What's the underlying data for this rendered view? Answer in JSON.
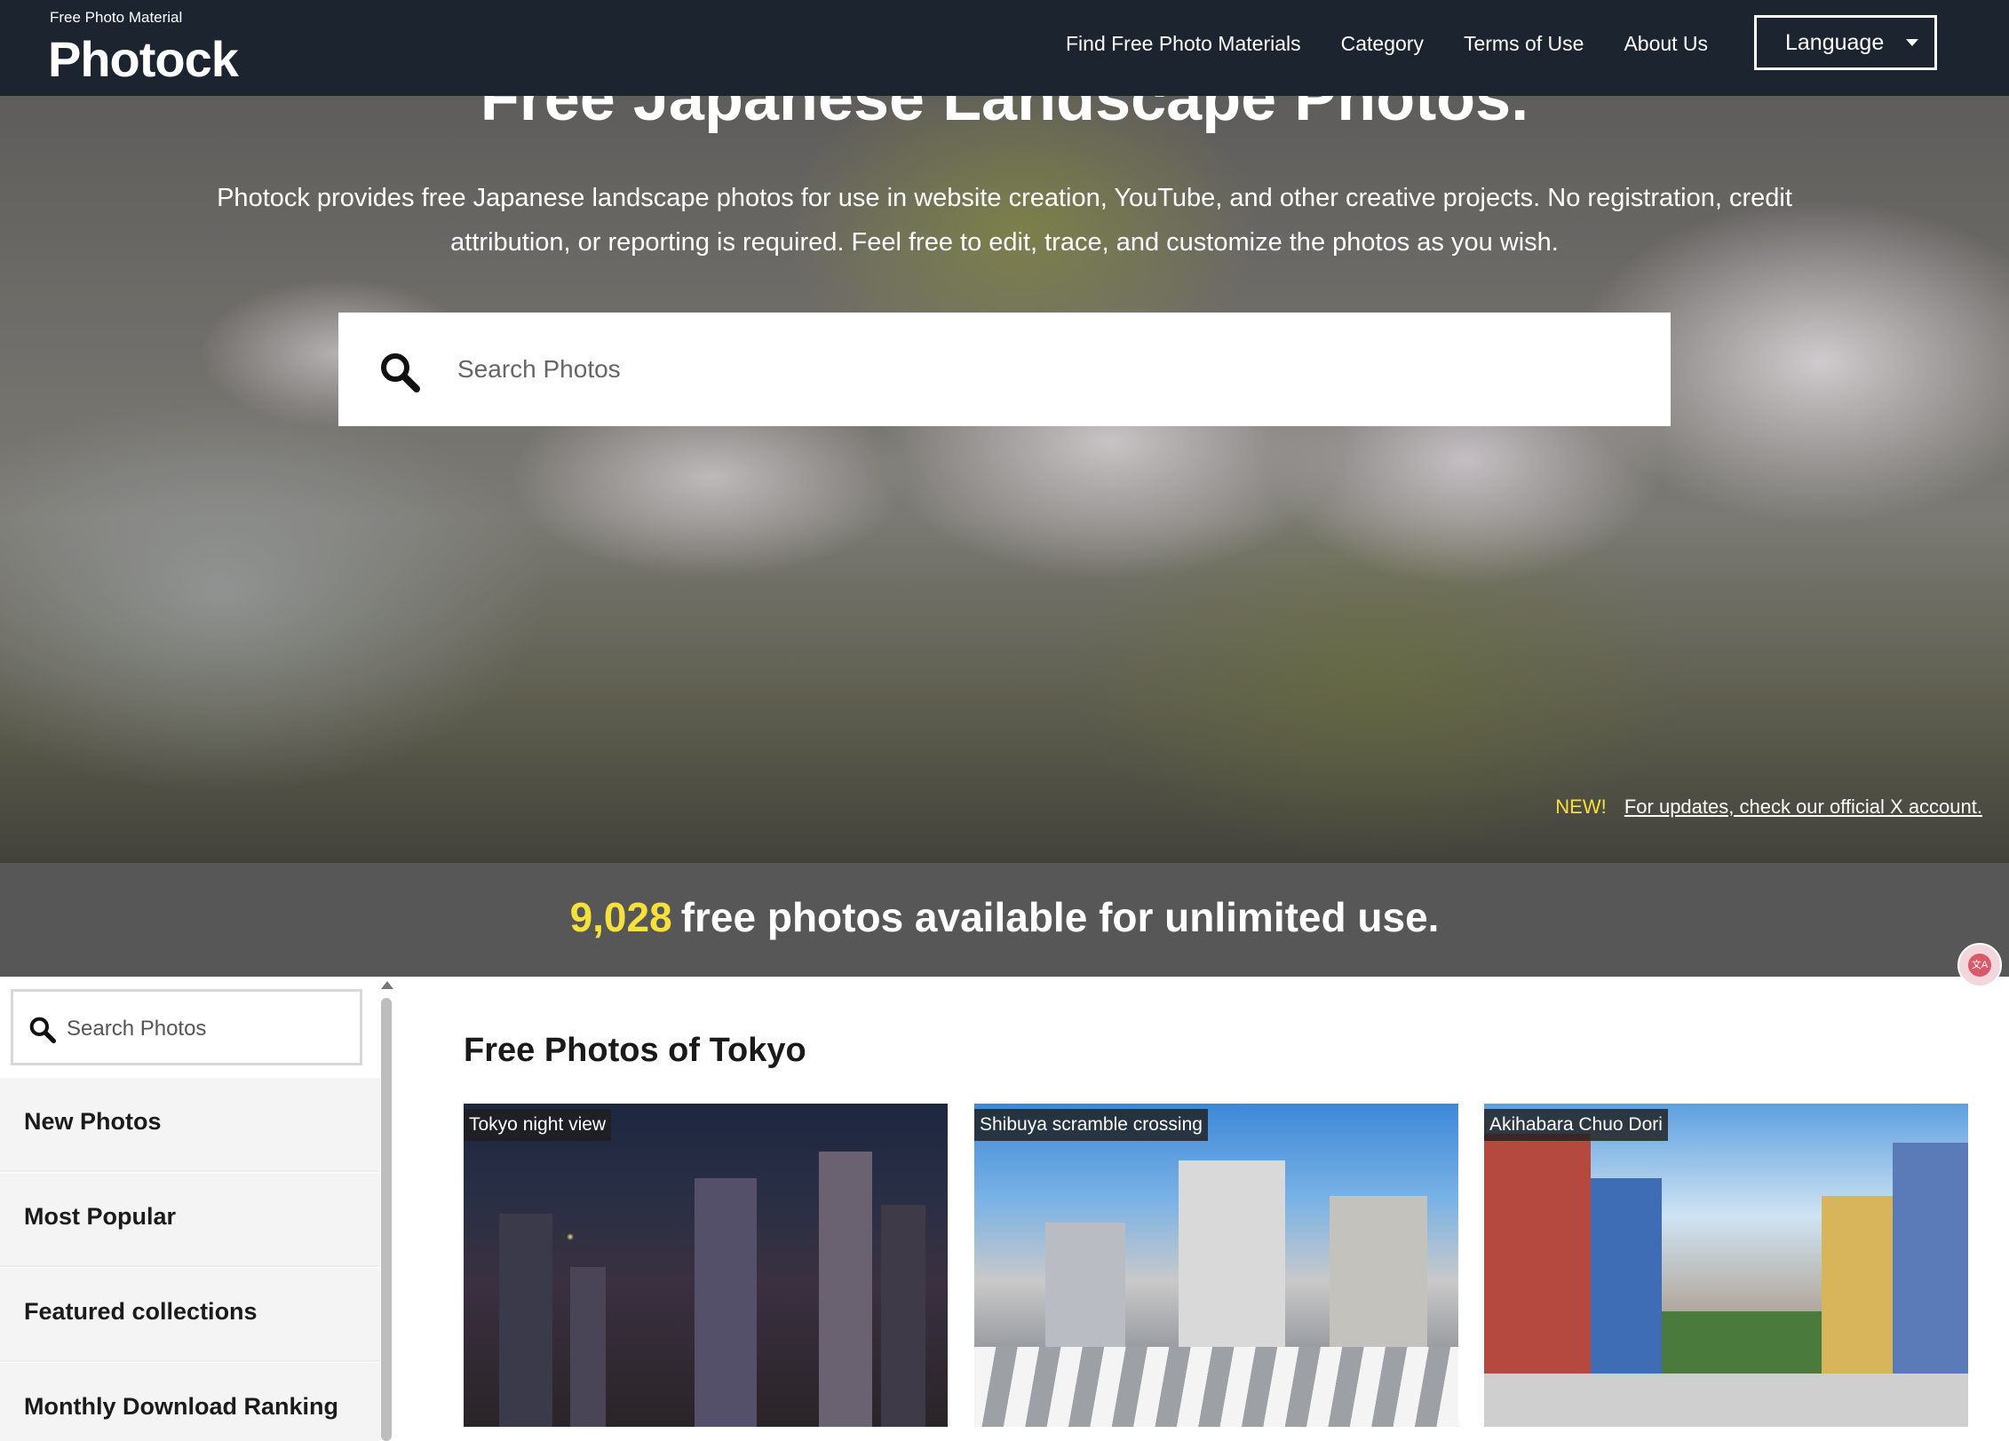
{
  "header": {
    "brand_tagline": "Free Photo Material",
    "brand_name": "Photock",
    "nav": [
      {
        "label": "Find Free Photo Materials"
      },
      {
        "label": "Category"
      },
      {
        "label": "Terms of Use"
      },
      {
        "label": "About Us"
      }
    ],
    "language_label": "Language"
  },
  "hero": {
    "title": "Free Japanese Landscape Photos.",
    "description": "Photock provides free Japanese landscape photos for use in website creation, YouTube, and other creative projects. No registration, credit attribution, or reporting is required. Feel free to edit, trace, and customize the photos as you wish.",
    "search_placeholder": "Search Photos",
    "news_label": "NEW!",
    "news_link": "For updates, check our official X account.",
    "count": "9,028",
    "count_suffix": "free photos available for unlimited use."
  },
  "sidebar": {
    "search_placeholder": "Search Photos",
    "items": [
      {
        "label": "New Photos"
      },
      {
        "label": "Most Popular"
      },
      {
        "label": "Featured collections"
      },
      {
        "label": "Monthly Download Ranking"
      }
    ]
  },
  "main": {
    "section_title": "Free Photos of Tokyo",
    "photos": [
      {
        "label": "Tokyo night view"
      },
      {
        "label": "Shibuya scramble crossing"
      },
      {
        "label": "Akihabara Chuo Dori"
      }
    ]
  },
  "colors": {
    "header_bg": "#1c2430",
    "accent_yellow": "#f5e13a",
    "sidebar_bg": "#f4f4f4"
  }
}
